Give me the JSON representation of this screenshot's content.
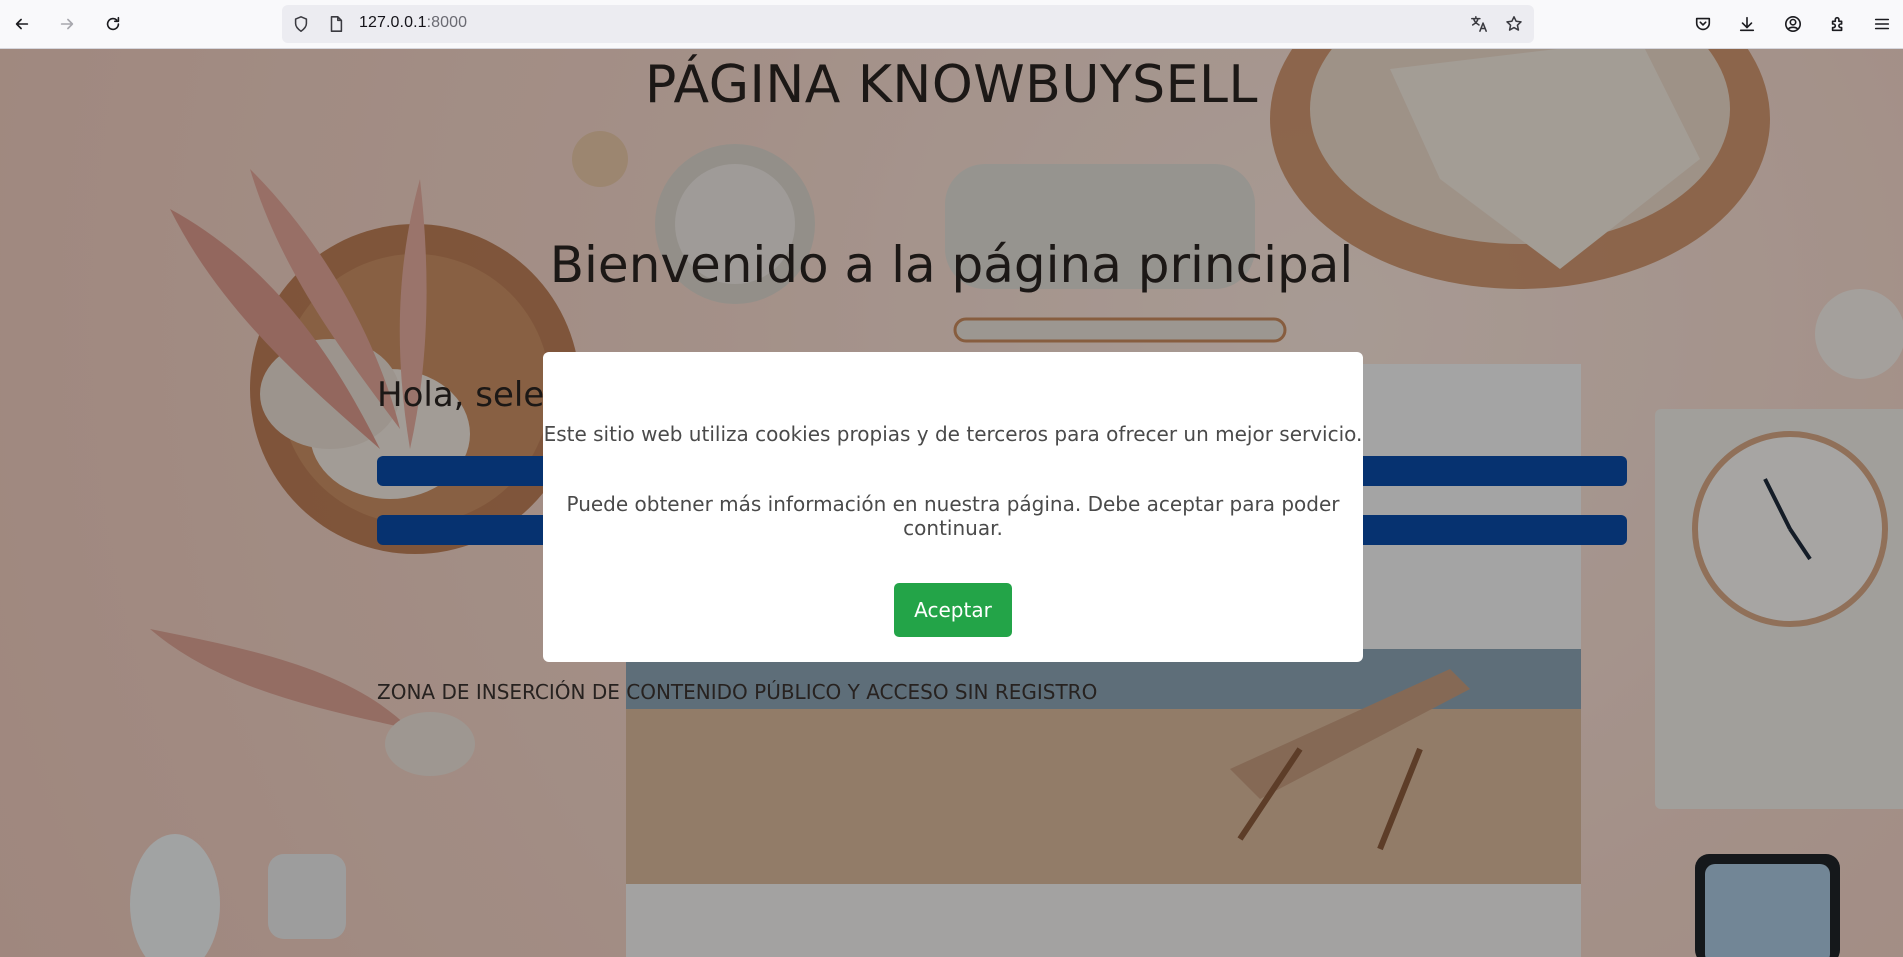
{
  "browser": {
    "url_host": "127.0.0.1",
    "url_port": ":8000"
  },
  "page": {
    "heading": "PÁGINA KNOWBUYSELL",
    "welcome": "Bienvenido a la página principal",
    "greeting": "Hola, selec",
    "zone_text": "ZONA DE INSERCIÓN DE CONTENIDO PÚBLICO Y ACCESO SIN REGISTRO",
    "role_bar_color": "#0a4aa6"
  },
  "cookie_modal": {
    "line1": "Este sitio web utiliza cookies propias y de terceros para ofrecer un mejor servicio.",
    "line2": "Puede obtener más información en nuestra página. Debe aceptar para poder continuar.",
    "accept_label": "Aceptar",
    "accept_color": "#23a448"
  }
}
